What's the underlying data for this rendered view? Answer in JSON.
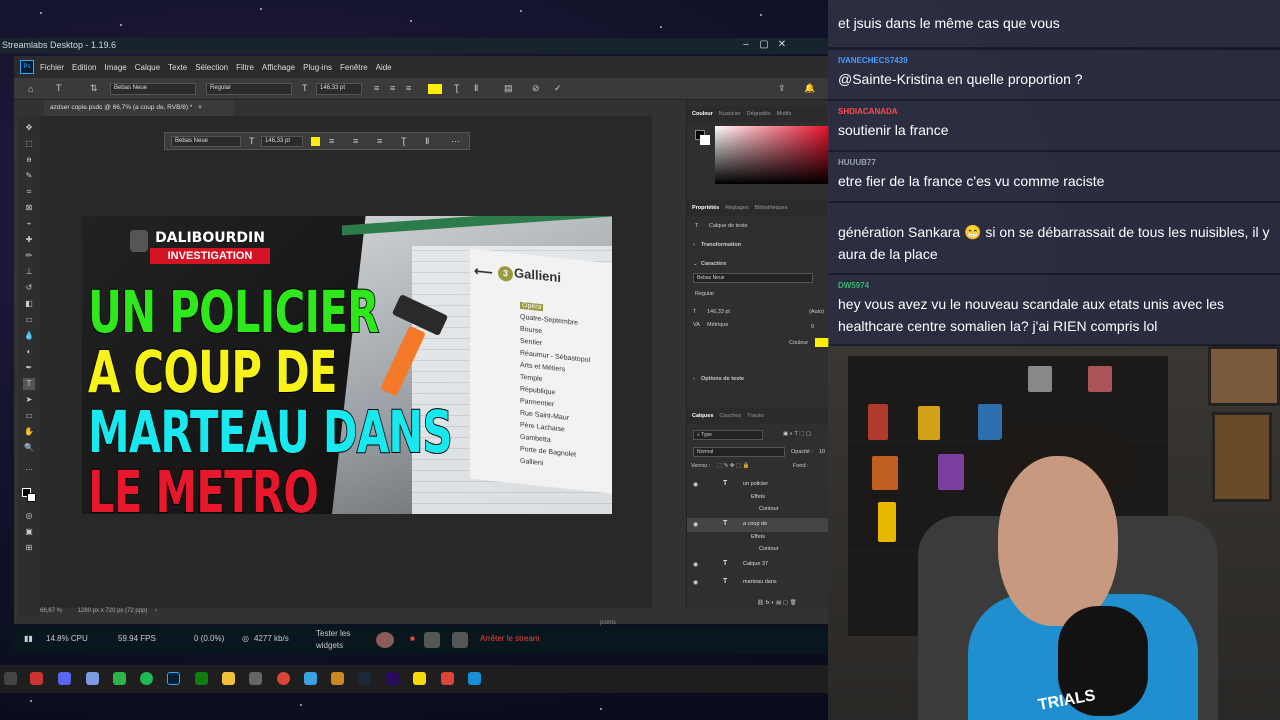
{
  "streamlabs": {
    "title": "Streamlabs Desktop - 1.19.6",
    "cpu": "14.8% CPU",
    "fps": "59.94 FPS",
    "dropped": "0 (0.0%)",
    "bitrate": "4277 kb/s",
    "test_widgets": "Tester les widgets",
    "stop_stream": "Arrêter le stream",
    "points_label": "points"
  },
  "photoshop": {
    "menu": [
      "Fichier",
      "Edition",
      "Image",
      "Calque",
      "Texte",
      "Sélection",
      "Filtre",
      "Affichage",
      "Plug-ins",
      "Fenêtre",
      "Aide"
    ],
    "font_family": "Bebas Neue",
    "font_style": "Regular",
    "font_size": "146,33 pt",
    "doc_tab": "azdser copie.psdc @ 66,7% (a coup de, RVB/8) *",
    "status_zoom": "66,67 %",
    "status_doc": "1280 px x 720 px (72 ppp)",
    "color_tabs": [
      "Couleur",
      "Nuancier",
      "Dégradés",
      "Motifs"
    ],
    "prop_tabs": [
      "Propriétés",
      "Réglages",
      "Bibliothèques"
    ],
    "prop_title": "Calque de texte",
    "transformation": "Transformation",
    "caractere": "Caractère",
    "prop_font": "Bebas Neue",
    "prop_style": "Regular",
    "prop_size": "146,33 pt",
    "prop_auto": "(Auto)",
    "prop_metric": "Métrique",
    "prop_tracking": "0",
    "prop_couleur": "Couleur",
    "options_texte": "Options de texte",
    "layer_tabs": [
      "Calques",
      "Couches",
      "Tracés"
    ],
    "layer_search": "Type",
    "blend_mode": "Normal",
    "opacity_label": "Opacité :",
    "opacity_value": "10",
    "lock_label": "Verrou :",
    "fill_label": "Fond :",
    "layers": [
      {
        "name": "un policier",
        "kind": "T"
      },
      {
        "name": "Effets",
        "kind": "fx"
      },
      {
        "name": "Contour",
        "kind": "sub"
      },
      {
        "name": "a coup de",
        "kind": "T"
      },
      {
        "name": "Effets",
        "kind": "fx"
      },
      {
        "name": "Contour",
        "kind": "sub"
      },
      {
        "name": "Calque 37",
        "kind": "T"
      },
      {
        "name": "marteau dans",
        "kind": "T"
      }
    ]
  },
  "thumbnail": {
    "logo_top": "DALIBOURDIN",
    "logo_bottom": "INVESTIGATION",
    "lines": [
      {
        "text": "UN POLICIER",
        "color": "#2ee81c"
      },
      {
        "text": "A COUP DE",
        "color": "#f7f21a"
      },
      {
        "text": "MARTEAU DANS",
        "color": "#19e8ef"
      },
      {
        "text": "LE METRO",
        "color": "#e8182c"
      }
    ],
    "station": "Gallieni",
    "line_number": "3",
    "stops": [
      "Opéra",
      "Quatre-Septembre",
      "Bourse",
      "Sentier",
      "Réaumur - Sébastopol",
      "Arts et Métiers",
      "Temple",
      "République",
      "Parmentier",
      "Rue Saint-Maur",
      "Père Lachaise",
      "Gambetta",
      "Porte de Bagnolet",
      "Gallieni"
    ]
  },
  "chat": {
    "messages": [
      {
        "user": "",
        "color": "#5a7cff",
        "text": "et jsuis dans le même cas que vous"
      },
      {
        "user": "IVANECHECS7439",
        "color": "#4a9eff",
        "text": "@Sainte-Kristina en quelle proportion ?"
      },
      {
        "user": "SHDIACANADA",
        "color": "#ff4d4d",
        "text": "soutienir la france"
      },
      {
        "user": "HUUUB77",
        "color": "#9aa0b0",
        "text": "etre fier de la france c'es vu comme raciste"
      },
      {
        "user": "",
        "color": "#8a2be2",
        "text": "génération Sankara 😁 si on se débarrassait de tous les nuisibles, il y aura de la place"
      },
      {
        "user": "DW5974",
        "color": "#3cb371",
        "text": "hey vous avez vu le nouveau scandale aux etats unis avec les healthcare centre somalien la? j'ai RIEN compris lol"
      }
    ]
  },
  "webcam": {
    "shirt_text": "TRIALS"
  },
  "colors": {
    "ps_bg": "#323232",
    "accent_yellow": "#ffee00",
    "stop_red": "#e74c3c"
  }
}
